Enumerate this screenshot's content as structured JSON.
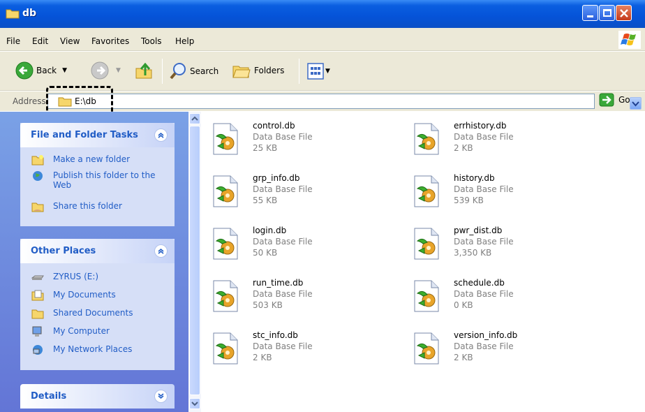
{
  "window": {
    "title": "db",
    "controls": [
      "minimize",
      "maximize",
      "close"
    ]
  },
  "menu": [
    {
      "label": "File"
    },
    {
      "label": "Edit"
    },
    {
      "label": "View"
    },
    {
      "label": "Favorites"
    },
    {
      "label": "Tools"
    },
    {
      "label": "Help"
    }
  ],
  "toolbar": {
    "back": "Back",
    "search": "Search",
    "folders": "Folders"
  },
  "address": {
    "label": "Address",
    "value": "E:\\db",
    "go": "Go"
  },
  "tasks": {
    "title": "File and Folder Tasks",
    "items": [
      {
        "label": "Make a new folder",
        "icon": "new-folder-icon"
      },
      {
        "label": "Publish this folder to the Web",
        "icon": "globe-icon"
      },
      {
        "label": "Share this folder",
        "icon": "share-folder-icon"
      }
    ]
  },
  "places": {
    "title": "Other Places",
    "items": [
      {
        "label": "ZYRUS (E:)",
        "icon": "drive-icon"
      },
      {
        "label": "My Documents",
        "icon": "documents-icon"
      },
      {
        "label": "Shared Documents",
        "icon": "folder-icon"
      },
      {
        "label": "My Computer",
        "icon": "computer-icon"
      },
      {
        "label": "My Network Places",
        "icon": "network-icon"
      }
    ]
  },
  "details": {
    "title": "Details"
  },
  "files": [
    {
      "name": "control.db",
      "type": "Data Base File",
      "size": "25 KB"
    },
    {
      "name": "errhistory.db",
      "type": "Data Base File",
      "size": "2 KB"
    },
    {
      "name": "grp_info.db",
      "type": "Data Base File",
      "size": "55 KB"
    },
    {
      "name": "history.db",
      "type": "Data Base File",
      "size": "539 KB"
    },
    {
      "name": "login.db",
      "type": "Data Base File",
      "size": "50 KB"
    },
    {
      "name": "pwr_dist.db",
      "type": "Data Base File",
      "size": "3,350 KB"
    },
    {
      "name": "run_time.db",
      "type": "Data Base File",
      "size": "503 KB"
    },
    {
      "name": "schedule.db",
      "type": "Data Base File",
      "size": "0 KB"
    },
    {
      "name": "stc_info.db",
      "type": "Data Base File",
      "size": "2 KB"
    },
    {
      "name": "version_info.db",
      "type": "Data Base File",
      "size": "2 KB"
    }
  ],
  "colors": {
    "titlebar": "#0553d8",
    "task_text": "#215dc6",
    "close": "#c4391b"
  }
}
